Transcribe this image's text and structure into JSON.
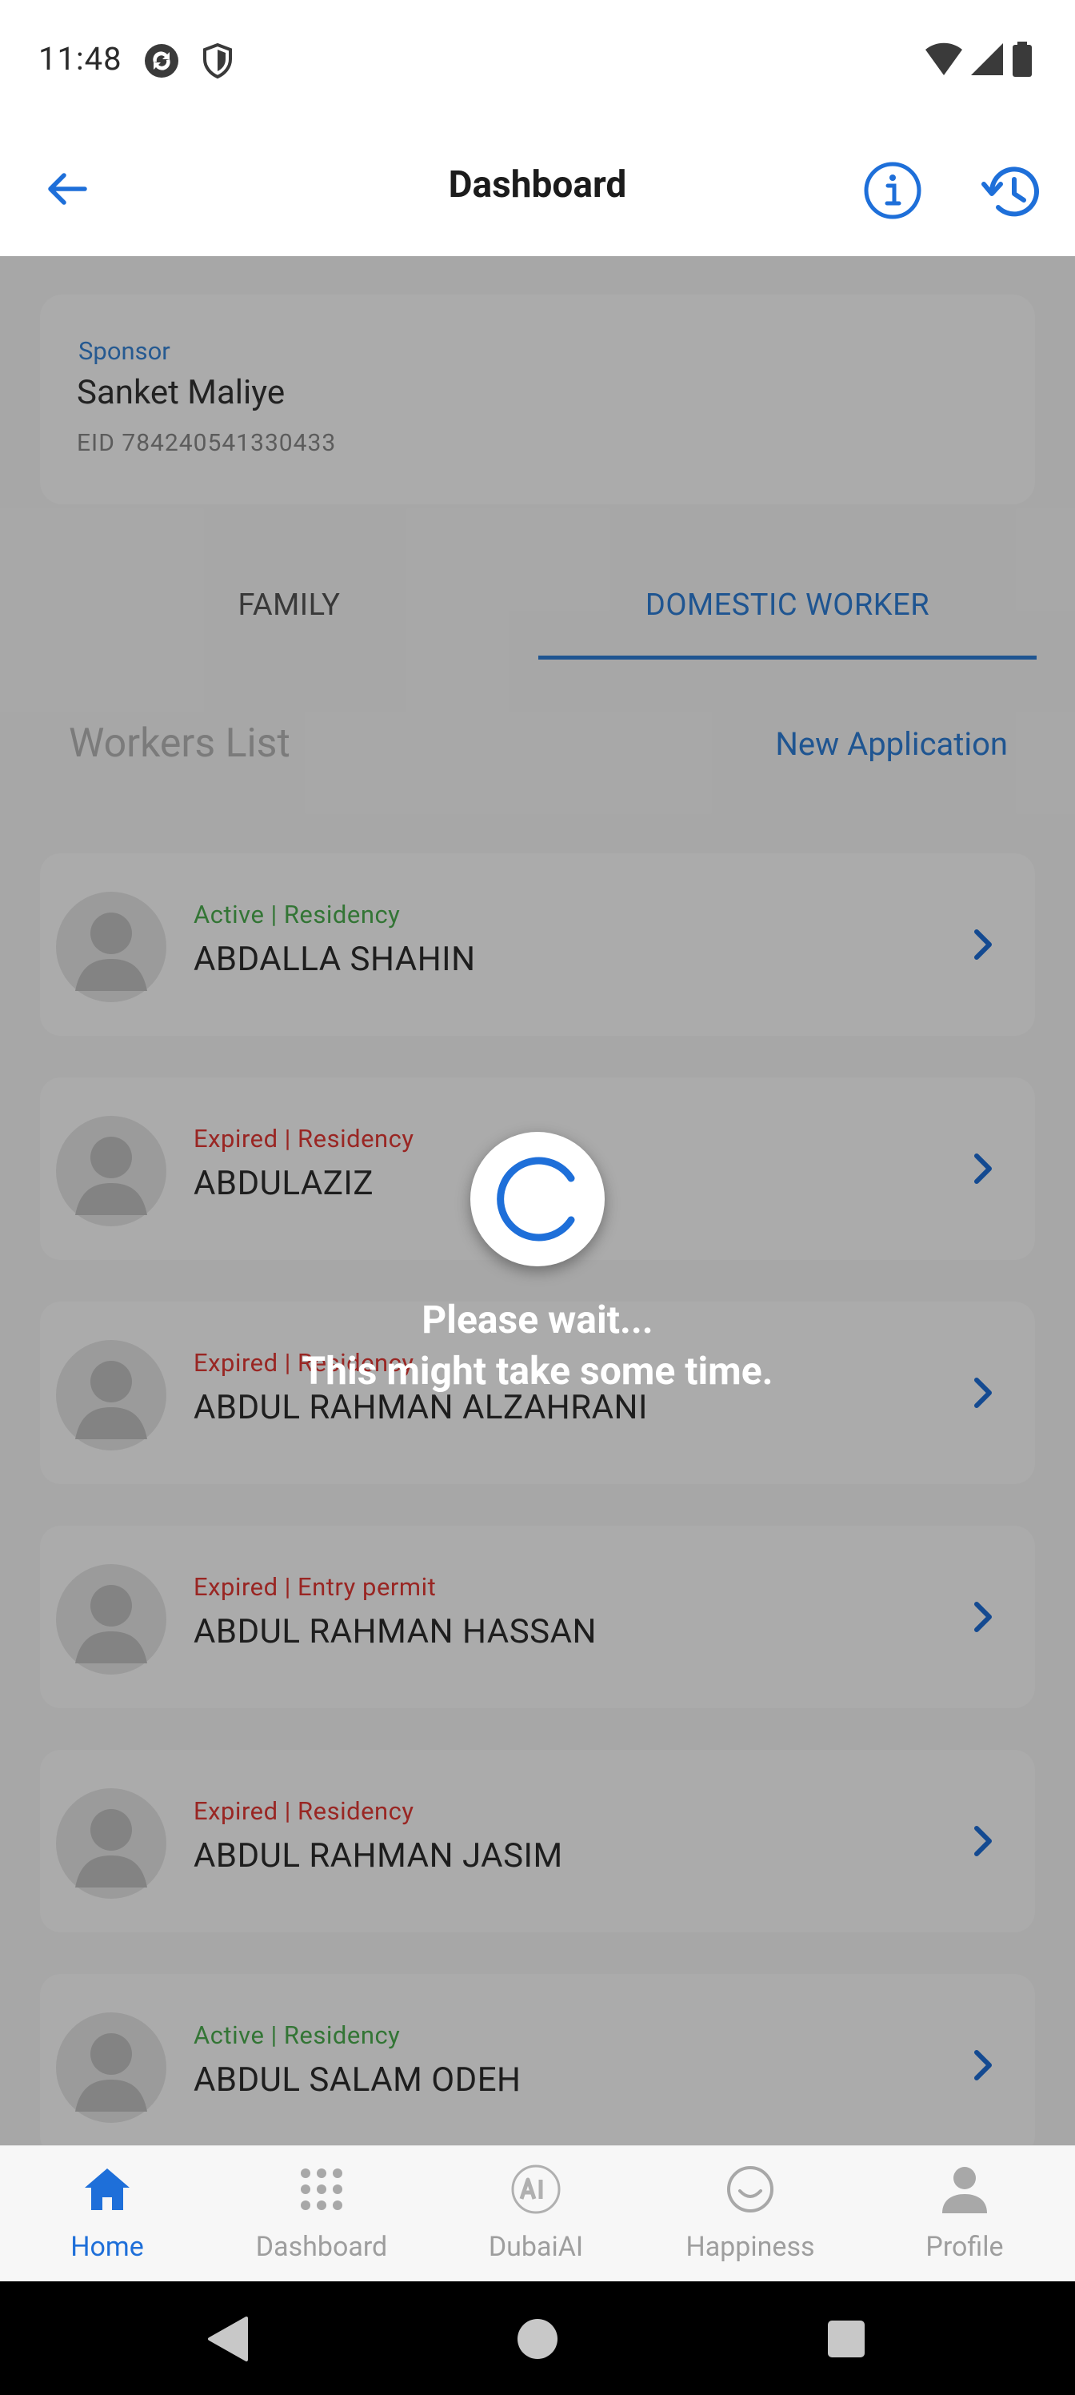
{
  "status_bar": {
    "time": "11:48",
    "left_icons": [
      "sync-icon",
      "shield-icon"
    ],
    "right_icons": [
      "wifi-icon",
      "signal-icon",
      "battery-icon"
    ]
  },
  "app_bar": {
    "title": "Dashboard",
    "back_icon": "arrow-left-icon",
    "info_icon": "info-icon",
    "history_icon": "history-icon"
  },
  "sponsor": {
    "label": "Sponsor",
    "name": "Sanket Maliye",
    "eid": "EID 784240541330433"
  },
  "tabs": [
    {
      "label": "FAMILY",
      "selected": false
    },
    {
      "label": "DOMESTIC WORKER",
      "selected": true
    }
  ],
  "workers": {
    "title": "Workers List",
    "new_application": "New Application",
    "items": [
      {
        "status": "Active | Residency",
        "state": "active",
        "name": "ABDALLA SHAHIN"
      },
      {
        "status": "Expired | Residency",
        "state": "expired",
        "name": "ABDULAZIZ"
      },
      {
        "status": "Expired | Residency",
        "state": "expired",
        "name": "ABDUL RAHMAN ALZAHRANI"
      },
      {
        "status": "Expired | Entry permit",
        "state": "expired",
        "name": "ABDUL RAHMAN HASSAN"
      },
      {
        "status": "Expired | Residency",
        "state": "expired",
        "name": "ABDUL RAHMAN JASIM"
      },
      {
        "status": "Active | Residency",
        "state": "active",
        "name": "ABDUL SALAM ODEH"
      }
    ]
  },
  "loading": {
    "line1": "Please wait...",
    "line2": "This might take some time."
  },
  "bottom_nav": [
    {
      "label": "Home",
      "icon": "home-icon",
      "active": true
    },
    {
      "label": "Dashboard",
      "icon": "grid-icon",
      "active": false
    },
    {
      "label": "DubaiAI",
      "icon": "ai-icon",
      "active": false
    },
    {
      "label": "Happiness",
      "icon": "smile-icon",
      "active": false
    },
    {
      "label": "Profile",
      "icon": "person-icon",
      "active": false
    }
  ],
  "colors": {
    "accent": "#2f7fd8",
    "active_status": "#4caf50",
    "expired_status": "#e53935",
    "overlay": "rgba(0,0,0,0.33)"
  }
}
